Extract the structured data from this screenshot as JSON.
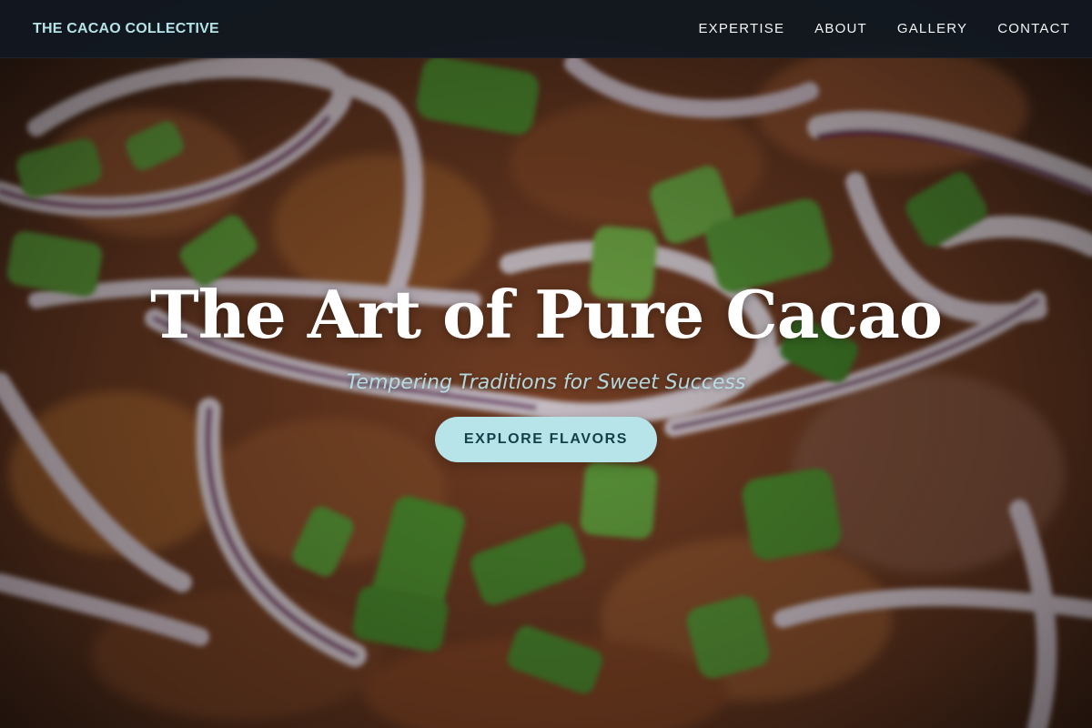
{
  "navbar": {
    "brand": "THE CACAO COLLECTIVE",
    "links": [
      {
        "label": "EXPERTISE"
      },
      {
        "label": "ABOUT"
      },
      {
        "label": "GALLERY"
      },
      {
        "label": "CONTACT"
      }
    ]
  },
  "hero": {
    "title": "The Art of Pure Cacao",
    "subtitle": "Tempering Traditions for Sweet Success",
    "cta_label": "EXPLORE FLAVORS",
    "background_icon": "food-photo"
  },
  "colors": {
    "navbar_bg": "#121821",
    "brand": "#b4e3e8",
    "cta_bg": "#b6e4e9",
    "cta_text": "#14404a",
    "subtitle": "#b9dfe6"
  }
}
